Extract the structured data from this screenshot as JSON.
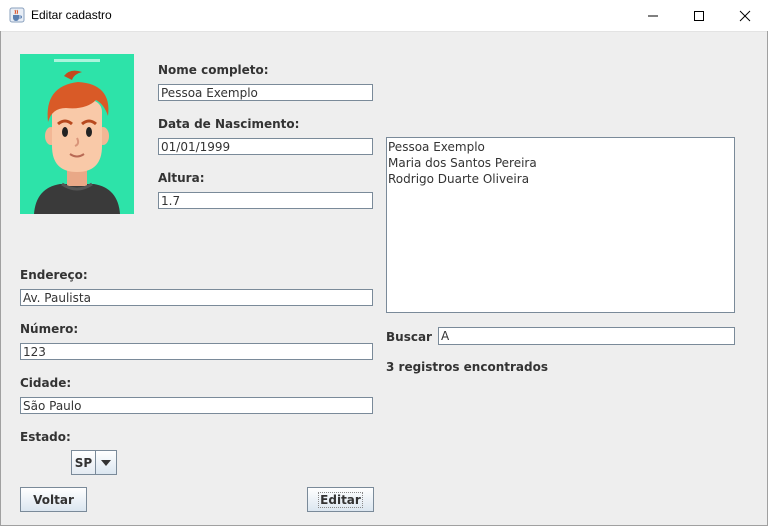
{
  "window": {
    "title": "Editar cadastro",
    "icons": [
      "java-cup-icon",
      "minimize-icon",
      "maximize-icon",
      "close-icon"
    ]
  },
  "form": {
    "nome_label": "Nome completo:",
    "nome_value": "Pessoa Exemplo",
    "nascimento_label": "Data de Nascimento:",
    "nascimento_value": "01/01/1999",
    "altura_label": "Altura:",
    "altura_value": "1.7",
    "endereco_label": "Endereço:",
    "endereco_value": "Av. Paulista",
    "numero_label": "Número:",
    "numero_value": "123",
    "cidade_label": "Cidade:",
    "cidade_value": "São Paulo",
    "estado_label": "Estado:",
    "estado_value": "SP"
  },
  "list": {
    "items": [
      "Pessoa Exemplo",
      "Maria dos Santos Pereira",
      "Rodrigo Duarte Oliveira"
    ]
  },
  "search": {
    "label": "Buscar",
    "value": "A",
    "status": "3 registros encontrados"
  },
  "buttons": {
    "back_label": "Voltar",
    "edit_label": "Editar"
  },
  "colors": {
    "avatar_background": "#2de3a9",
    "hair": "#d95a27",
    "skin": "#f9c9a8",
    "shirt": "#3a3a3a"
  }
}
